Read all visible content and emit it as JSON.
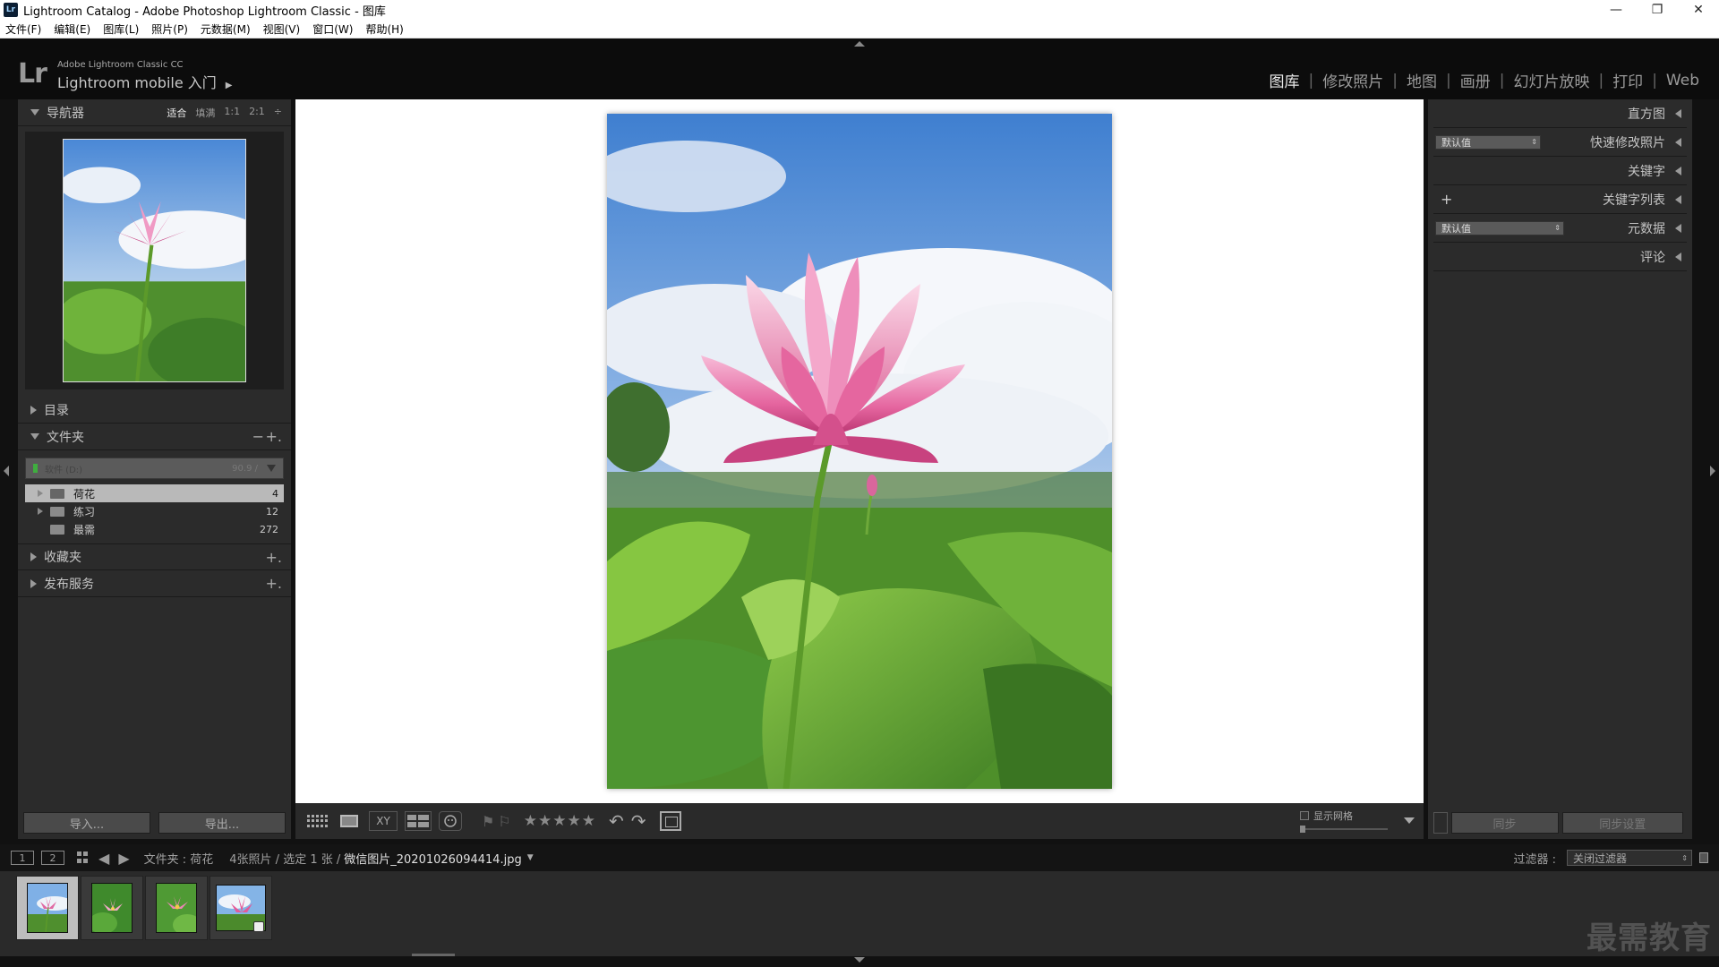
{
  "window": {
    "title": "Lightroom Catalog - Adobe Photoshop Lightroom Classic - 图库",
    "app_badge": "Lr",
    "minimize": "—",
    "maximize": "❐",
    "close": "✕"
  },
  "menu": [
    "文件(F)",
    "编辑(E)",
    "图库(L)",
    "照片(P)",
    "元数据(M)",
    "视图(V)",
    "窗口(W)",
    "帮助(H)"
  ],
  "identity": {
    "logo": "Lr",
    "small": "Adobe Lightroom Classic CC",
    "large": "Lightroom mobile 入门",
    "arrow": "▶"
  },
  "modules": [
    {
      "label": "图库",
      "active": true
    },
    {
      "label": "修改照片"
    },
    {
      "label": "地图"
    },
    {
      "label": "画册"
    },
    {
      "label": "幻灯片放映"
    },
    {
      "label": "打印"
    },
    {
      "label": "Web"
    }
  ],
  "navigator": {
    "title": "导航器",
    "zoom_fit": "适合",
    "zoom_fill": "填满",
    "zoom_1": "1:1",
    "zoom_2": "2:1",
    "zoom_more": "÷"
  },
  "catalog": {
    "title": "目录"
  },
  "folders": {
    "title": "文件夹",
    "minus": "−",
    "plus": "+.",
    "volume_name": "软件 (D:)",
    "volume_size": "90.9 /",
    "items": [
      {
        "name": "荷花",
        "count": "4",
        "selected": true
      },
      {
        "name": "练习",
        "count": "12"
      },
      {
        "name": "最需",
        "count": "272"
      }
    ]
  },
  "collections": {
    "title": "收藏夹",
    "plus": "+."
  },
  "publish": {
    "title": "发布服务",
    "plus": "+."
  },
  "left_buttons": {
    "import": "导入...",
    "export": "导出..."
  },
  "right_panel": {
    "histogram": "直方图",
    "quick_develop": "快速修改照片",
    "quick_develop_preset": "默认值",
    "keywording": "关键字",
    "keyword_list": "关键字列表",
    "keyword_plus": "+",
    "metadata": "元数据",
    "metadata_preset": "默认值",
    "comments": "评论",
    "select_arrows": "⇕"
  },
  "right_buttons": {
    "sync": "同步",
    "sync_settings": "同步设置"
  },
  "toolbar": {
    "compare_label": "XY",
    "flag": "⚑",
    "reject": "⚐",
    "rating": 0,
    "rating_max": 5,
    "rotate_left": "↶",
    "rotate_right": "↷",
    "show_grid": "显示网格"
  },
  "filmstrip_bar": {
    "view1": "1",
    "view2": "2",
    "back": "◀",
    "forward": "▶",
    "source": "文件夹 : 荷花",
    "count": "4张照片 / 选定 1 张 /",
    "filename": "微信图片_20201026094414.jpg",
    "filename_arrow": "▼",
    "filter_label": "过滤器 :",
    "filter_value": "关闭过滤器",
    "filter_arrows": "⇕"
  },
  "filmstrip": {
    "count": 4,
    "selected_index": 0
  },
  "watermark": "最需教育",
  "colors": {
    "panel": "#2b2b2b",
    "background": "#111111",
    "loupe_bg": "#ffffff",
    "accent_selected": "#bdbdbd"
  }
}
